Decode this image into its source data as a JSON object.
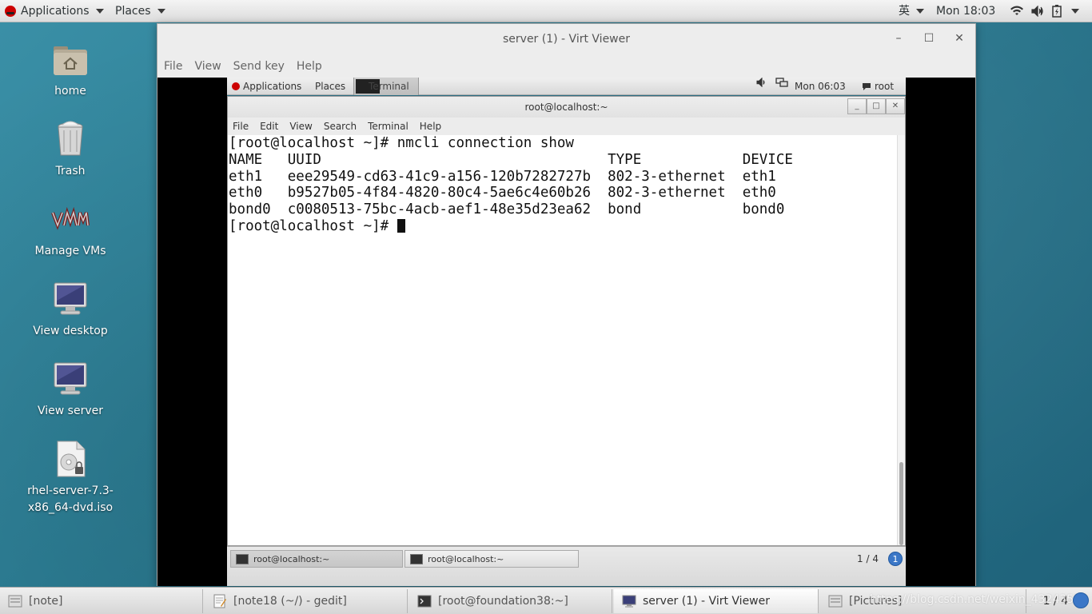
{
  "host_topbar": {
    "applications": "Applications",
    "places": "Places",
    "input_method": "英",
    "clock": "Mon 18:03"
  },
  "desktop_icons": [
    {
      "label": "home"
    },
    {
      "label": "Trash"
    },
    {
      "label": "Manage VMs"
    },
    {
      "label": "View desktop"
    },
    {
      "label": "View server"
    },
    {
      "label": "rhel-server-7.3-x86_64-dvd.iso"
    }
  ],
  "virt_viewer": {
    "title": "server (1) - Virt Viewer",
    "menu": [
      "File",
      "View",
      "Send key",
      "Help"
    ]
  },
  "guest_topbar": {
    "applications": "Applications",
    "places": "Places",
    "terminal": "Terminal",
    "clock": "Mon 06:03",
    "user": "root"
  },
  "guest_terminal": {
    "title": "root@localhost:~",
    "menu": [
      "File",
      "Edit",
      "View",
      "Search",
      "Terminal",
      "Help"
    ],
    "lines": [
      "[root@localhost ~]# nmcli connection show",
      "NAME   UUID                                  TYPE            DEVICE",
      "eth1   eee29549-cd63-41c9-a156-120b7282727b  802-3-ethernet  eth1",
      "eth0   b9527b05-4f84-4820-80c4-5ae6c4e60b26  802-3-ethernet  eth0",
      "bond0  c0080513-75bc-4acb-aef1-48e35d23ea62  bond            bond0"
    ],
    "prompt": "[root@localhost ~]# "
  },
  "guest_taskbar": {
    "tasks": [
      "root@localhost:~",
      "root@localhost:~"
    ],
    "page": "1 / 4",
    "badge": "1"
  },
  "host_taskbar": {
    "tasks": [
      "[note]",
      "[note18 (~/) - gedit]",
      "[root@foundation38:~]",
      "server (1) - Virt Viewer",
      "[Pictures]"
    ],
    "page": "1 / 4",
    "watermark": "https://blog.csdn.net/weixin_43243528"
  }
}
